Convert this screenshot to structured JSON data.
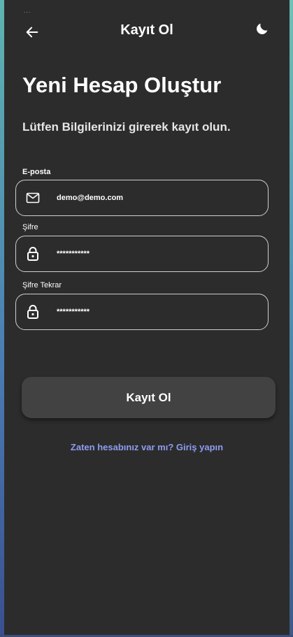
{
  "status_bar": {
    "dots": "..."
  },
  "appbar": {
    "title": "Kayıt Ol",
    "back_icon": "arrow-left-icon",
    "theme_icon": "moon-icon"
  },
  "heading": {
    "title": "Yeni Hesap Oluştur",
    "subtitle": "Lütfen Bilgilerinizi girerek kayıt olun."
  },
  "form": {
    "email": {
      "label": "E-posta",
      "value": "demo@demo.com",
      "icon": "mail-icon"
    },
    "password": {
      "label": "Şifre",
      "value": "***********",
      "icon": "lock-icon"
    },
    "password_repeat": {
      "label": "Şifre Tekrar",
      "value": "***********",
      "icon": "lock-icon"
    }
  },
  "submit_label": "Kayıt Ol",
  "login_link": "Zaten hesabınız var mı? Giriş yapın",
  "colors": {
    "background": "#2c2c2c",
    "button": "#424242",
    "link": "#8e9cf0",
    "border": "#cfcfcf"
  }
}
